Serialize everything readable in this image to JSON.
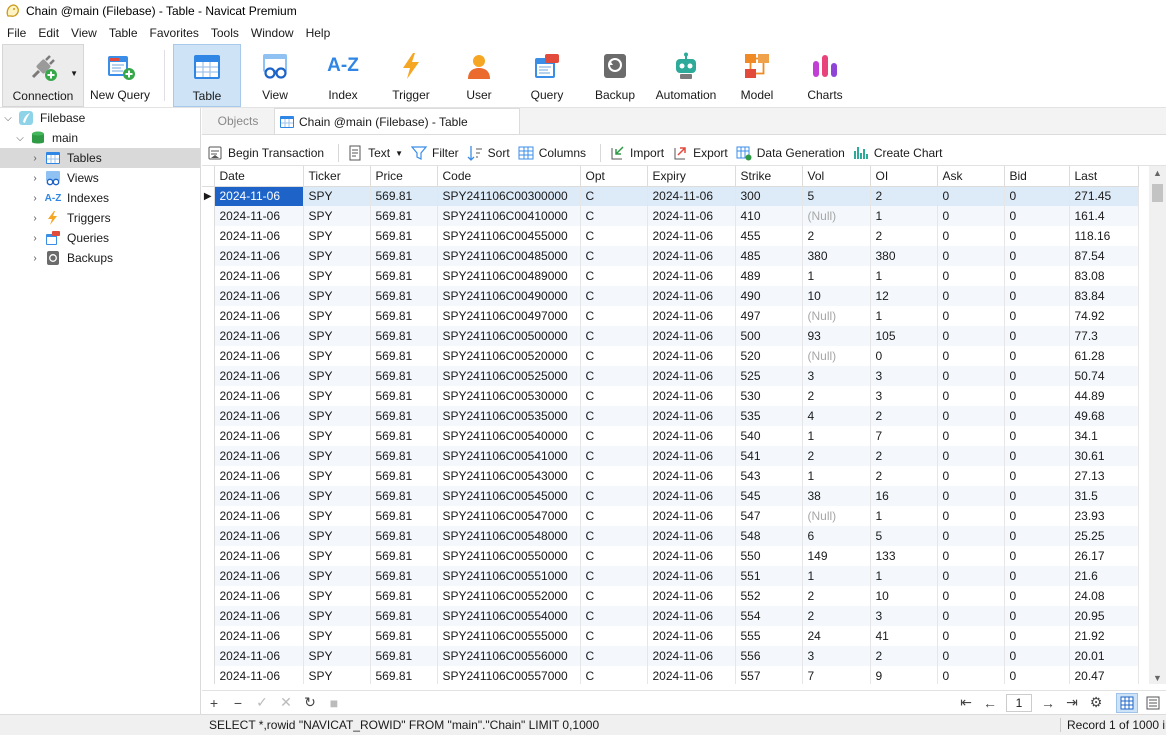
{
  "window": {
    "title": "Chain @main (Filebase) - Table - Navicat Premium"
  },
  "menu": [
    "File",
    "Edit",
    "View",
    "Table",
    "Favorites",
    "Tools",
    "Window",
    "Help"
  ],
  "toolbar": {
    "connection": "Connection",
    "new_query": "New Query",
    "items": [
      "Table",
      "View",
      "Index",
      "Trigger",
      "User",
      "Query",
      "Backup",
      "Automation",
      "Model",
      "Charts"
    ],
    "index_glyph": "A-Z"
  },
  "sidebar": {
    "root": "Filebase",
    "db": "main",
    "items": [
      "Tables",
      "Views",
      "Indexes",
      "Triggers",
      "Queries",
      "Backups"
    ],
    "index_glyph": "A-Z"
  },
  "tabs": {
    "objects": "Objects",
    "active": "Chain @main (Filebase) - Table"
  },
  "subtoolbar": {
    "begin_transaction": "Begin Transaction",
    "text": "Text",
    "filter": "Filter",
    "sort": "Sort",
    "columns": "Columns",
    "import": "Import",
    "export": "Export",
    "data_generation": "Data Generation",
    "create_chart": "Create Chart"
  },
  "grid": {
    "columns": [
      "Date",
      "Ticker",
      "Price",
      "Code",
      "Opt",
      "Expiry",
      "Strike",
      "Vol",
      "OI",
      "Ask",
      "Bid",
      "Last"
    ],
    "rows": [
      [
        "2024-11-06",
        "SPY",
        "569.81",
        "SPY241106C00300000",
        "C",
        "2024-11-06",
        "300",
        "5",
        "2",
        "0",
        "0",
        "271.45"
      ],
      [
        "2024-11-06",
        "SPY",
        "569.81",
        "SPY241106C00410000",
        "C",
        "2024-11-06",
        "410",
        "(Null)",
        "1",
        "0",
        "0",
        "161.4"
      ],
      [
        "2024-11-06",
        "SPY",
        "569.81",
        "SPY241106C00455000",
        "C",
        "2024-11-06",
        "455",
        "2",
        "2",
        "0",
        "0",
        "118.16"
      ],
      [
        "2024-11-06",
        "SPY",
        "569.81",
        "SPY241106C00485000",
        "C",
        "2024-11-06",
        "485",
        "380",
        "380",
        "0",
        "0",
        "87.54"
      ],
      [
        "2024-11-06",
        "SPY",
        "569.81",
        "SPY241106C00489000",
        "C",
        "2024-11-06",
        "489",
        "1",
        "1",
        "0",
        "0",
        "83.08"
      ],
      [
        "2024-11-06",
        "SPY",
        "569.81",
        "SPY241106C00490000",
        "C",
        "2024-11-06",
        "490",
        "10",
        "12",
        "0",
        "0",
        "83.84"
      ],
      [
        "2024-11-06",
        "SPY",
        "569.81",
        "SPY241106C00497000",
        "C",
        "2024-11-06",
        "497",
        "(Null)",
        "1",
        "0",
        "0",
        "74.92"
      ],
      [
        "2024-11-06",
        "SPY",
        "569.81",
        "SPY241106C00500000",
        "C",
        "2024-11-06",
        "500",
        "93",
        "105",
        "0",
        "0",
        "77.3"
      ],
      [
        "2024-11-06",
        "SPY",
        "569.81",
        "SPY241106C00520000",
        "C",
        "2024-11-06",
        "520",
        "(Null)",
        "0",
        "0",
        "0",
        "61.28"
      ],
      [
        "2024-11-06",
        "SPY",
        "569.81",
        "SPY241106C00525000",
        "C",
        "2024-11-06",
        "525",
        "3",
        "3",
        "0",
        "0",
        "50.74"
      ],
      [
        "2024-11-06",
        "SPY",
        "569.81",
        "SPY241106C00530000",
        "C",
        "2024-11-06",
        "530",
        "2",
        "3",
        "0",
        "0",
        "44.89"
      ],
      [
        "2024-11-06",
        "SPY",
        "569.81",
        "SPY241106C00535000",
        "C",
        "2024-11-06",
        "535",
        "4",
        "2",
        "0",
        "0",
        "49.68"
      ],
      [
        "2024-11-06",
        "SPY",
        "569.81",
        "SPY241106C00540000",
        "C",
        "2024-11-06",
        "540",
        "1",
        "7",
        "0",
        "0",
        "34.1"
      ],
      [
        "2024-11-06",
        "SPY",
        "569.81",
        "SPY241106C00541000",
        "C",
        "2024-11-06",
        "541",
        "2",
        "2",
        "0",
        "0",
        "30.61"
      ],
      [
        "2024-11-06",
        "SPY",
        "569.81",
        "SPY241106C00543000",
        "C",
        "2024-11-06",
        "543",
        "1",
        "2",
        "0",
        "0",
        "27.13"
      ],
      [
        "2024-11-06",
        "SPY",
        "569.81",
        "SPY241106C00545000",
        "C",
        "2024-11-06",
        "545",
        "38",
        "16",
        "0",
        "0",
        "31.5"
      ],
      [
        "2024-11-06",
        "SPY",
        "569.81",
        "SPY241106C00547000",
        "C",
        "2024-11-06",
        "547",
        "(Null)",
        "1",
        "0",
        "0",
        "23.93"
      ],
      [
        "2024-11-06",
        "SPY",
        "569.81",
        "SPY241106C00548000",
        "C",
        "2024-11-06",
        "548",
        "6",
        "5",
        "0",
        "0",
        "25.25"
      ],
      [
        "2024-11-06",
        "SPY",
        "569.81",
        "SPY241106C00550000",
        "C",
        "2024-11-06",
        "550",
        "149",
        "133",
        "0",
        "0",
        "26.17"
      ],
      [
        "2024-11-06",
        "SPY",
        "569.81",
        "SPY241106C00551000",
        "C",
        "2024-11-06",
        "551",
        "1",
        "1",
        "0",
        "0",
        "21.6"
      ],
      [
        "2024-11-06",
        "SPY",
        "569.81",
        "SPY241106C00552000",
        "C",
        "2024-11-06",
        "552",
        "2",
        "10",
        "0",
        "0",
        "24.08"
      ],
      [
        "2024-11-06",
        "SPY",
        "569.81",
        "SPY241106C00554000",
        "C",
        "2024-11-06",
        "554",
        "2",
        "3",
        "0",
        "0",
        "20.95"
      ],
      [
        "2024-11-06",
        "SPY",
        "569.81",
        "SPY241106C00555000",
        "C",
        "2024-11-06",
        "555",
        "24",
        "41",
        "0",
        "0",
        "21.92"
      ],
      [
        "2024-11-06",
        "SPY",
        "569.81",
        "SPY241106C00556000",
        "C",
        "2024-11-06",
        "556",
        "3",
        "2",
        "0",
        "0",
        "20.01"
      ],
      [
        "2024-11-06",
        "SPY",
        "569.81",
        "SPY241106C00557000",
        "C",
        "2024-11-06",
        "557",
        "7",
        "9",
        "0",
        "0",
        "20.47"
      ]
    ]
  },
  "pager": {
    "page": "1"
  },
  "status": {
    "sql": "SELECT *,rowid \"NAVICAT_ROWID\" FROM \"main\".\"Chain\" LIMIT 0,1000",
    "record": "Record 1 of 1000 in page 1"
  },
  "colors": {
    "selection": "#1e64c8",
    "active_tool": "#cfe3f6",
    "alt_row": "#f4f8fd"
  }
}
